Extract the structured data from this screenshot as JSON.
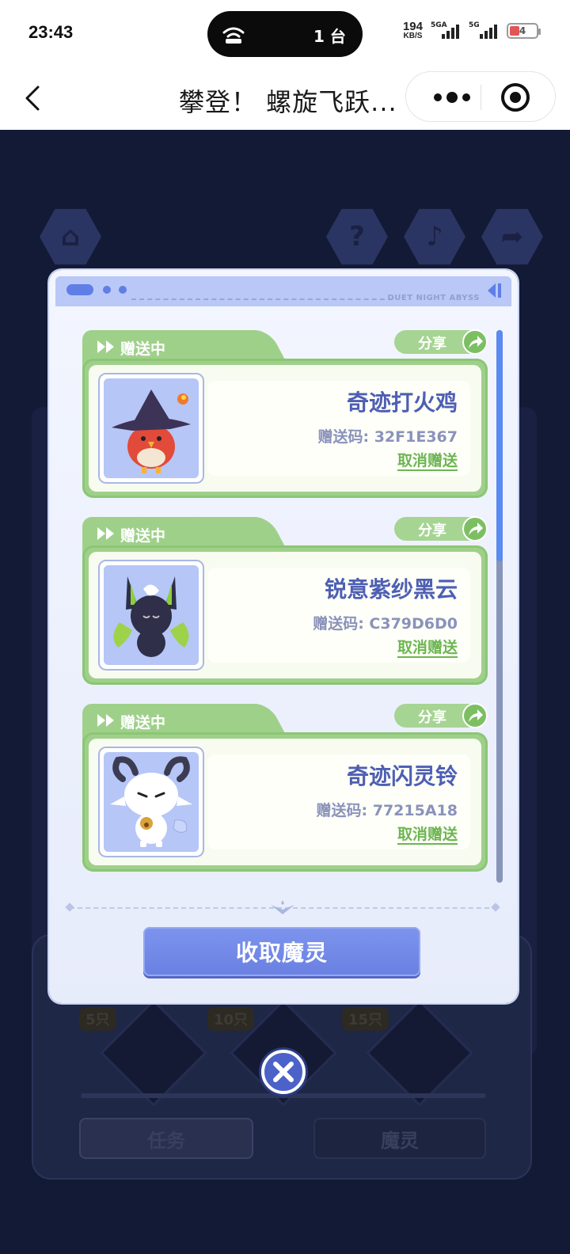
{
  "status_bar": {
    "time": "23:43",
    "island_count": "1 台",
    "speed_value": "194",
    "speed_unit": "KB/S",
    "signal1": "5GA",
    "signal2": "5G",
    "battery": "4",
    "battery_color": "#e25555"
  },
  "navbar": {
    "title": "攀登！ 螺旋飞跃...",
    "icons": [
      "back-chevron-icon",
      "more-dots-icon",
      "target-icon"
    ]
  },
  "game_bg": {
    "tags": [
      "5只",
      "10只",
      "15只"
    ],
    "buttons": [
      "任务",
      "魔灵"
    ]
  },
  "modal": {
    "brand": "DUET NIGHT ABYSS",
    "accent": "#6a80e2",
    "card_green": "#9fd08a",
    "cards": [
      {
        "status": "赠送中",
        "share": "分享",
        "name": "奇迹打火鸡",
        "code": "赠送码: 32F1E367",
        "cancel": "取消赠送"
      },
      {
        "status": "赠送中",
        "share": "分享",
        "name": "锐意紫纱黑云",
        "code": "赠送码: C379D6D0",
        "cancel": "取消赠送"
      },
      {
        "status": "赠送中",
        "share": "分享",
        "name": "奇迹闪灵铃",
        "code": "赠送码: 77215A18",
        "cancel": "取消赠送"
      }
    ],
    "collect_button": "收取魔灵",
    "close_icon": "close-x-icon"
  }
}
